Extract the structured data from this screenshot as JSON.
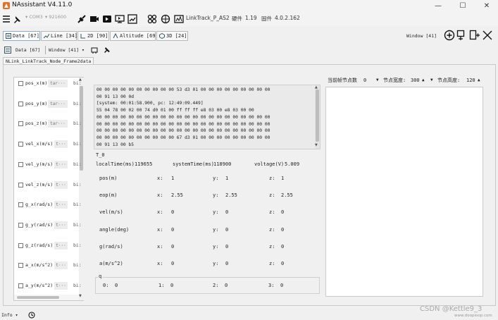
{
  "title": "NAssistant V4.11.0",
  "window_controls": {
    "minimize": "—",
    "maximize": "☐",
    "close": "✕"
  },
  "toolbar": {
    "port": "COM3",
    "baud": "921600",
    "device": "LinkTrack_P_AS2",
    "hw_label": "硬件",
    "hw_version": "1.19",
    "fw_label": "固件",
    "fw_version": "4.0.2.162",
    "icons": [
      "menu-icon",
      "pin-icon",
      "connect-icon",
      "record-icon",
      "play-icon",
      "screen-icon",
      "chart-icon",
      "nodes-icon",
      "compass-icon",
      "signal-icon"
    ]
  },
  "tabs": [
    {
      "label": "Data [67]",
      "active": true
    },
    {
      "label": "Line [34]",
      "active": false
    },
    {
      "label": "2D [90]",
      "active": false
    },
    {
      "label": "Altitude [69]",
      "active": false
    },
    {
      "label": "3D [24]",
      "active": false
    }
  ],
  "window_label": "Window [41]",
  "subbar": {
    "data_label": "Data [67]",
    "window_label": "Window [41]"
  },
  "frame_tab": "NLink_LinkTrack_Node_Frame2data",
  "variables": [
    {
      "name": "pos_x(m)",
      "value": "tar···",
      "suffix": "bi:"
    },
    {
      "name": "pos_y(m)",
      "value": "tar···",
      "suffix": "bi:"
    },
    {
      "name": "pos_z(m)",
      "value": "tar···",
      "suffix": "bi:"
    },
    {
      "name": "vel_x(m/s)",
      "value": "t···",
      "suffix": "bi:"
    },
    {
      "name": "vel_y(m/s)",
      "value": "t···",
      "suffix": "bi:"
    },
    {
      "name": "vel_z(m/s)",
      "value": "t···",
      "suffix": "bi:"
    },
    {
      "name": "g_x(rad/s)",
      "value": "t···",
      "suffix": "bi:"
    },
    {
      "name": "g_y(rad/s)",
      "value": "t···",
      "suffix": "bi:"
    },
    {
      "name": "g_z(rad/s)",
      "value": "t···",
      "suffix": "bi:"
    },
    {
      "name": "a_x(m/s^2)",
      "value": "t···",
      "suffix": "bi:"
    },
    {
      "name": "a_y(m/s^2)",
      "value": "t···",
      "suffix": "bi:"
    }
  ],
  "hex_lines": [
    "00 00 00 00 00 00 00 00 00 00 53 d3 01 00 00 00 00 00 00 00 00 00",
    "00 91 13 00 0d",
    "[system: 00:01:58.900, pc: 12:49:09.449]",
    "55 04 78 00 02 00 74 d0 01 00 ff ff ff e8 03 00 e8 03 00 00",
    "00 00 00 00 00 00 00 00 00 00 00 00 00 00 00 00 00 00 00 00 00 00",
    "00 00 00 00 00 00 00 00 00 00 00 00 00 00 00 00 00 00 00 00 00 00",
    "00 00 00 00 00 00 00 00 00 00 00 00 00 00 00 00 00 00 00 00 00 00",
    "00 00 00 00 00 00 00 00 00 00 67 d3 01 00 00 00 00 00 00 00 00 00",
    "00 91 13 00 b5"
  ],
  "frame": {
    "t0": "T_0",
    "local_time_label": "localTime(ms)",
    "local_time": "119655",
    "system_time_label": "systemTime(ms)",
    "system_time": "118900",
    "voltage_label": "voltage(V)",
    "voltage": "5.009",
    "rows": [
      {
        "label": "pos(m)",
        "x": "1",
        "y": "1",
        "z": "1"
      },
      {
        "label": "eop(m)",
        "x": "2.55",
        "y": "2.55",
        "z": "2.55"
      },
      {
        "label": "vel(m/s)",
        "x": "0",
        "y": "0",
        "z": "0"
      },
      {
        "label": "angle(deg)",
        "x": "0",
        "y": "0",
        "z": "0"
      },
      {
        "label": "g(rad/s)",
        "x": "0",
        "y": "0",
        "z": "0"
      },
      {
        "label": "a(m/s^2)",
        "x": "0",
        "y": "0",
        "z": "0"
      }
    ],
    "axis": {
      "x": "x:",
      "y": "y:",
      "z": "z:"
    },
    "q_label": "q",
    "q": [
      {
        "k": "0:",
        "v": "0"
      },
      {
        "k": "1:",
        "v": "0"
      },
      {
        "k": "2:",
        "v": "0"
      },
      {
        "k": "3:",
        "v": "0"
      }
    ]
  },
  "node_controls": {
    "count_label": "当前帧节点数",
    "count": "0",
    "width_label": "节点宽度:",
    "width": "300",
    "height_label": "节点高度:",
    "height": "120"
  },
  "statusbar": {
    "level": "Info"
  },
  "watermark": {
    "line1": "CSDN @Kettle9_3",
    "line2": "www.doopioop.com"
  }
}
